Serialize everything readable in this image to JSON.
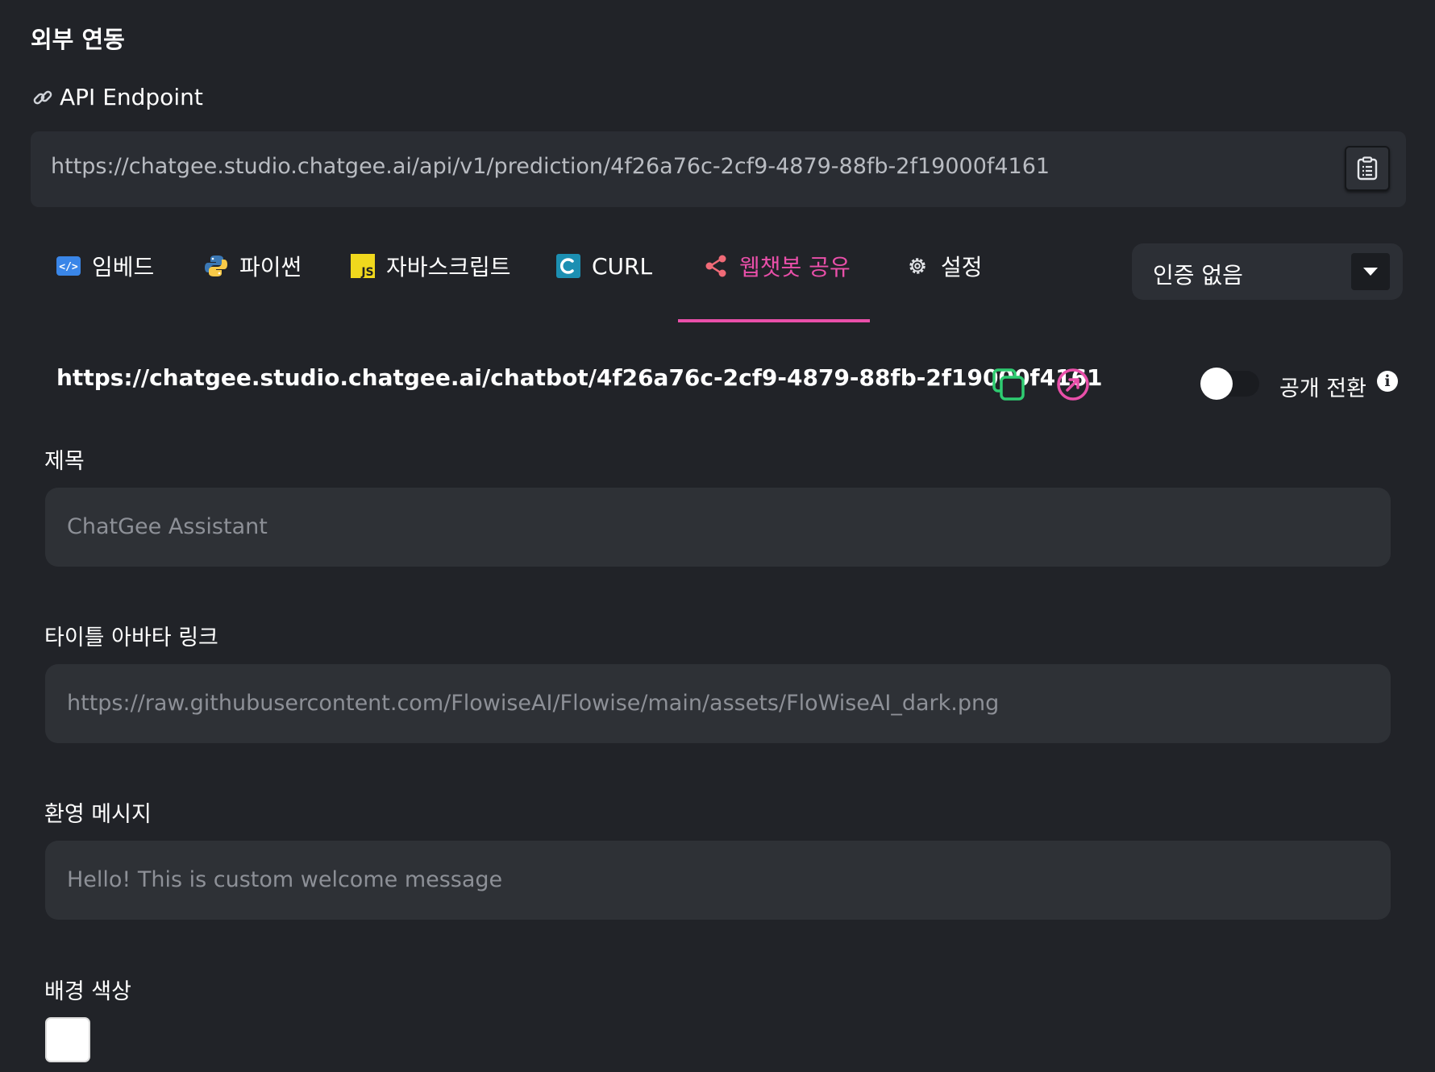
{
  "page": {
    "title": "외부 연동",
    "api_label": "API Endpoint",
    "endpoint_url": "https://chatgee.studio.chatgee.ai/api/v1/prediction/4f26a76c-2cf9-4879-88fb-2f19000f4161"
  },
  "tabs": [
    {
      "label": "임베드",
      "icon": "embed-code-icon"
    },
    {
      "label": "파이썬",
      "icon": "python-icon"
    },
    {
      "label": "자바스크립트",
      "icon": "javascript-icon"
    },
    {
      "label": "CURL",
      "icon": "curl-icon"
    },
    {
      "label": "웹챗봇 공유",
      "icon": "share-icon",
      "active": true
    },
    {
      "label": "설정",
      "icon": "gear-icon"
    }
  ],
  "auth": {
    "selected": "인증 없음"
  },
  "share": {
    "url": "https://chatgee.studio.chatgee.ai/chatbot/4f26a76c-2cf9-4879-88fb-2f19000f4161",
    "public_toggle_label": "공개 전환",
    "public_toggle_on": false
  },
  "form": {
    "title_label": "제목",
    "title_placeholder": "ChatGee Assistant",
    "avatar_label": "타이틀 아바타 링크",
    "avatar_placeholder": "https://raw.githubusercontent.com/FlowiseAI/Flowise/main/assets/FloWiseAI_dark.png",
    "welcome_label": "환영 메시지",
    "welcome_placeholder": "Hello! This is custom welcome message",
    "bg_color_label": "배경 색상",
    "bg_color_value": "#ffffff"
  },
  "colors": {
    "accent": "#e94fa9",
    "copy_green": "#2ecc71",
    "background": "#212328"
  }
}
